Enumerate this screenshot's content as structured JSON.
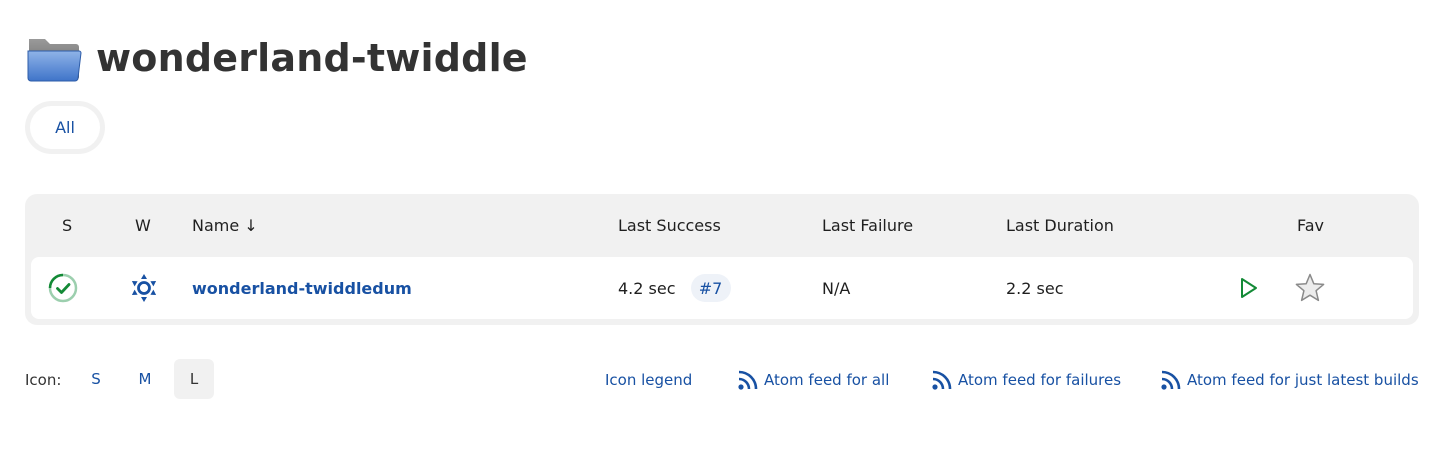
{
  "page": {
    "title": "wonderland-twiddle"
  },
  "views": {
    "tabs": [
      {
        "label": "All",
        "active": true
      }
    ]
  },
  "table": {
    "columns": {
      "status": "S",
      "weather": "W",
      "name": "Name ↓",
      "last_success": "Last Success",
      "last_failure": "Last Failure",
      "last_duration": "Last Duration",
      "fav": "Fav"
    },
    "rows": [
      {
        "name": "wonderland-twiddledum",
        "status": "success",
        "status_icon": "success-check-icon",
        "weather_icon": "sunny-weather-icon",
        "last_success": "4.2 sec",
        "last_success_build": "#7",
        "last_failure": "N/A",
        "last_duration": "2.2 sec",
        "actions": [
          "build-play-icon",
          "favorite-star-icon"
        ]
      }
    ]
  },
  "footer": {
    "icon_label": "Icon:",
    "icon_sizes": [
      {
        "label": "S",
        "active": false
      },
      {
        "label": "M",
        "active": false
      },
      {
        "label": "L",
        "active": true
      }
    ],
    "links": {
      "legend": "Icon legend",
      "feed_all": "Atom feed for all",
      "feed_failures": "Atom feed for failures",
      "feed_latest": "Atom feed for just latest builds"
    }
  },
  "colors": {
    "link": "#1851a3",
    "success": "#138a36",
    "header_bg": "#f1f1f1",
    "title": "#333333"
  }
}
